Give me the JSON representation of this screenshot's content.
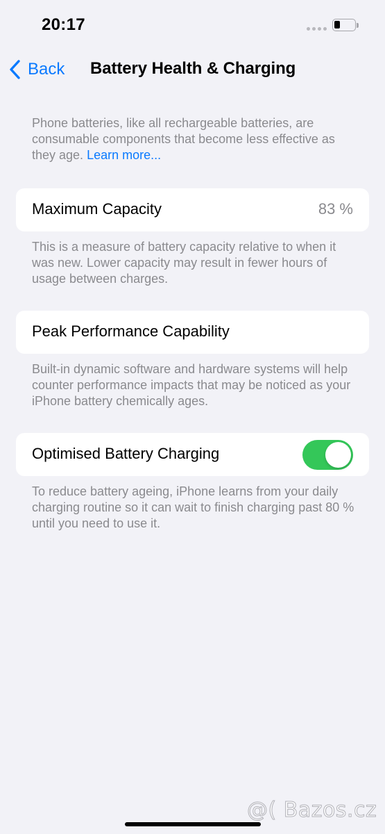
{
  "status_bar": {
    "time": "20:17",
    "battery_level": 0.3
  },
  "nav": {
    "back_label": "Back",
    "title": "Battery Health & Charging"
  },
  "intro": {
    "text": "Phone batteries, like all rechargeable batteries, are consumable components that become less effective as they age. ",
    "link": "Learn more..."
  },
  "max_capacity": {
    "label": "Maximum Capacity",
    "value": "83 %",
    "note": "This is a measure of battery capacity relative to when it was new. Lower capacity may result in fewer hours of usage between charges."
  },
  "peak_performance": {
    "label": "Peak Performance Capability",
    "note": "Built-in dynamic software and hardware systems will help counter performance impacts that may be noticed as your iPhone battery chemically ages."
  },
  "optimised_charging": {
    "label": "Optimised Battery Charging",
    "enabled": true,
    "note": "To reduce battery ageing, iPhone learns from your daily charging routine so it can wait to finish charging past 80 % until you need to use it."
  },
  "watermark": "@( Bazos.cz",
  "colors": {
    "accent": "#0a7aff",
    "toggle_on": "#34c759",
    "background": "#f2f2f7",
    "secondary_text": "#8a8a8e"
  },
  "icons": {
    "back": "chevron-left-icon",
    "battery": "battery-icon",
    "signal": "signal-dots-icon"
  }
}
